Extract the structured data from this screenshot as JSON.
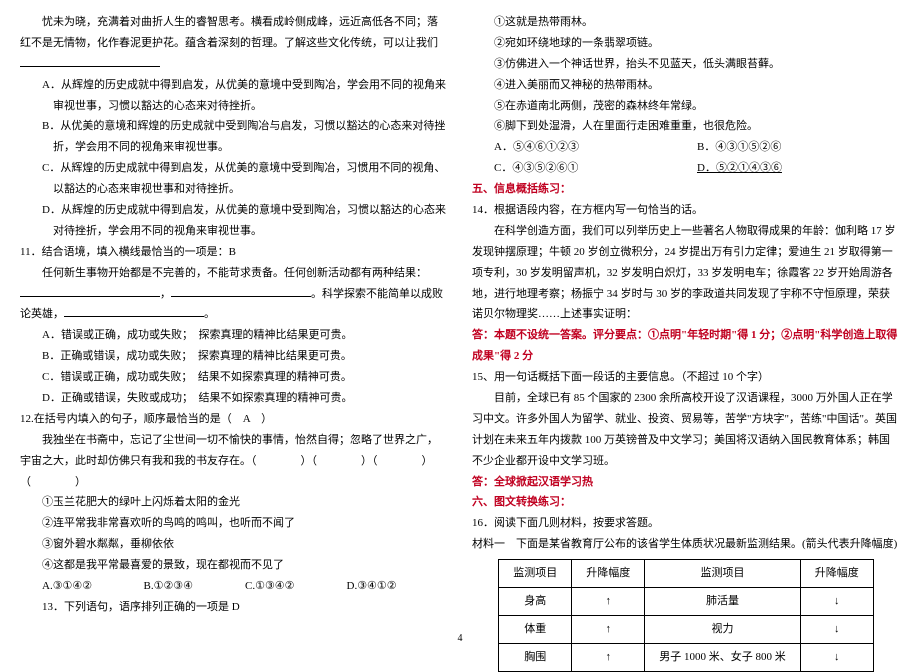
{
  "left": {
    "intro": "忧未为晓，充满着对曲折人生的睿智思考。横看成岭侧成峰，远近高低各不同；落红不是无情物，化作春泥更护花。蕴含着深刻的哲理。了解这些文化传统，可以让我们",
    "q10": {
      "A": "A．从辉煌的历史成就中得到启发，从优美的意境中受到陶冶，学会用不同的视角来审视世事，习惯以豁达的心态来对待挫折。",
      "B": "B．从优美的意境和辉煌的历史成就中受到陶冶与启发，习惯以豁达的心态来对待挫折，学会用不同的视角来审视世事。",
      "C": "C．从辉煌的历史成就中得到启发，从优美的意境中受到陶冶，习惯用不同的视角、以豁达的心态来审视世事和对待挫折。",
      "D": "D．从辉煌的历史成就中得到启发，从优美的意境中受到陶冶，习惯以豁达的心态来对待挫折，学会用不同的视角来审视世事。"
    },
    "q11": {
      "stem": "11．结合语境，填入横线最恰当的一项是：B",
      "body1": "任何新生事物开始都是不完善的，不能苛求责备。任何创新活动都有两种结果：",
      "bodyMid": "，",
      "body2": "。科学探索不能简单以成败论英雄，",
      "bodyEnd": "。",
      "A": "A．错误或正确，成功或失败；　探索真理的精神比结果更可贵。",
      "B": "B．正确或错误，成功或失败；　探索真理的精神比结果更可贵。",
      "C": "C．错误或正确，成功或失败；　结果不如探索真理的精神可贵。",
      "D": "D．正确或错误，失败或成功；　结果不如探索真理的精神可贵。"
    },
    "q12": {
      "stem": "12.在括号内填入的句子，顺序最恰当的是（　A　）",
      "body": "我独坐在书斋中，忘记了尘世间一切不愉快的事情，怡然自得；忽略了世界之广，宇宙之大，此时却仿佛只有我和我的书友存在。（　　　　）（　　　　）（　　　　）（　　　　）",
      "l1": "①玉兰花肥大的绿叶上闪烁着太阳的金光",
      "l2": "②连平常我非常喜欢听的鸟鸣的鸣叫，也听而不闻了",
      "l3": "③窗外碧水粼粼，垂柳依依",
      "l4": "④这都是我平常最喜爱的景致，现在都视而不见了",
      "choices": {
        "A": "A.③①④②",
        "B": "B.①②③④",
        "C": "C.①③④②",
        "D": "D.③④①②"
      }
    },
    "q13": "13．下列语句，语序排列正确的一项是 D"
  },
  "right": {
    "lines": {
      "l1": "①这就是热带雨林。",
      "l2": "②宛如环绕地球的一条翡翠项链。",
      "l3": "③仿佛进入一个神话世界，抬头不见蓝天，低头满眼苔藓。",
      "l4": "④进入美丽而又神秘的热带雨林。",
      "l5": "⑤在赤道南北两侧，茂密的森林终年常绿。",
      "l6": "⑥脚下到处湿滑，人在里面行走困难重重，也很危险。"
    },
    "choices": {
      "A": "A．⑤④⑥①②③",
      "B": "B．④③①⑤②⑥",
      "C": "C．④③⑤②⑥①",
      "D": "D．⑤②①④③⑥"
    },
    "sec5": "五、信息概括练习：",
    "q14": {
      "stem": "14．根据语段内容，在方框内写一句恰当的话。",
      "body": "在科学创造方面，我们可以列举历史上一些著名人物取得成果的年龄：伽利略 17 岁发现钟摆原理；牛顿 20 岁创立微积分，24 岁提出万有引力定律；爱迪生 21 岁取得第一项专利，30 岁发明留声机，32 岁发明白炽灯，33 岁发明电车；徐霞客 22 岁开始周游各地，进行地理考察；杨振宁 34 岁时与 30 岁的李政道共同发现了宇称不守恒原理，荣获诺贝尔物理奖……上述事实证明：",
      "ans": "答：本题不设统一答案。评分要点：①点明\"年轻时期\"得 1 分；②点明\"科学创造上取得成果\"得 2 分"
    },
    "q15": {
      "stem": "15、用一句话概括下面一段话的主要信息。（不超过 10 个字）",
      "body": "目前，全球已有 85 个国家的 2300 余所高校开设了汉语课程，3000 万外国人正在学习中文。许多外国人为留学、就业、投资、贸易等，苦学\"方块字\"，苦练\"中国话\"。英国计划在未来五年内拨款 100 万英镑普及中文学习；美国将汉语纳入国民教育体系；韩国不少企业都开设中文学习班。",
      "ans": "答：全球掀起汉语学习热"
    },
    "sec6": "六、图文转换练习：",
    "q16": {
      "stem": "16．阅读下面几则材料，按要求答题。",
      "mat": "材料一　下面是某省教育厅公布的该省学生体质状况最新监测结果。(箭头代表升降幅度)"
    },
    "table": {
      "h1": "监测项目",
      "h2": "升降幅度",
      "h3": "监测项目",
      "h4": "升降幅度",
      "r1c1": "身高",
      "r1c2": "↑",
      "r1c3": "肺活量",
      "r1c4": "↓",
      "r2c1": "体重",
      "r2c2": "↑",
      "r2c3": "视力",
      "r2c4": "↓",
      "r3c1": "胸围",
      "r3c2": "↑",
      "r3c3": "男子 1000 米、女子 800 米",
      "r3c4": "↓"
    }
  },
  "pagenum": "4",
  "chart_data": {
    "type": "table",
    "title": "学生体质状况最新监测结果",
    "columns": [
      "监测项目",
      "升降幅度",
      "监测项目",
      "升降幅度"
    ],
    "rows": [
      [
        "身高",
        "↑",
        "肺活量",
        "↓"
      ],
      [
        "体重",
        "↑",
        "视力",
        "↓"
      ],
      [
        "胸围",
        "↑",
        "男子 1000 米、女子 800 米",
        "↓"
      ]
    ]
  }
}
